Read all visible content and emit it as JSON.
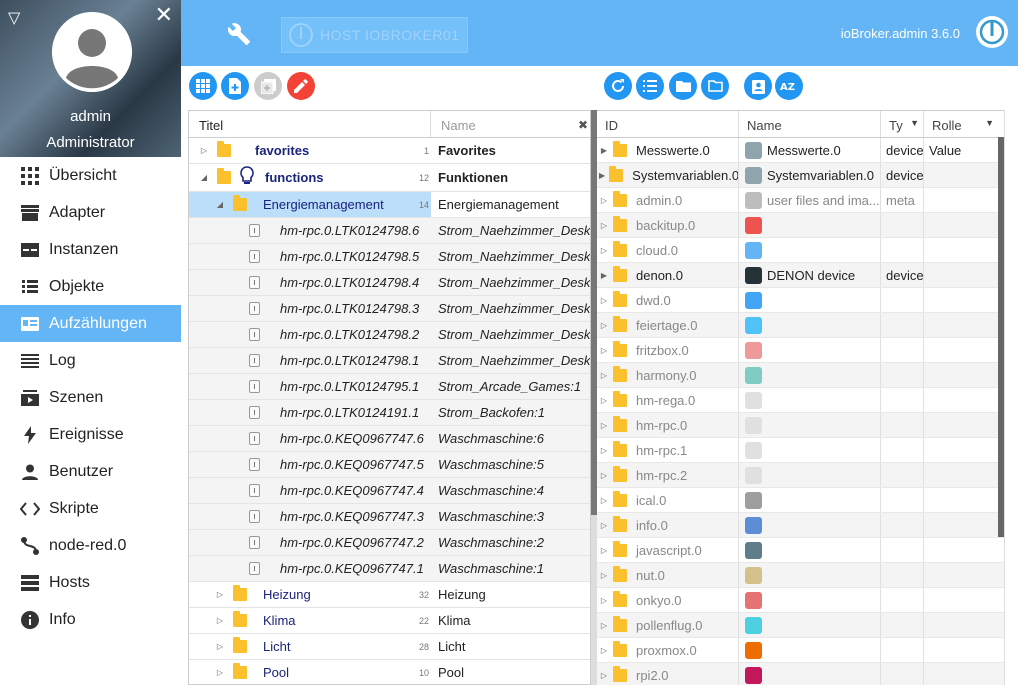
{
  "sidebar": {
    "user": "admin",
    "role": "Administrator",
    "items": [
      {
        "label": "Übersicht",
        "icon": "grid-icon"
      },
      {
        "label": "Adapter",
        "icon": "store-icon"
      },
      {
        "label": "Instanzen",
        "icon": "instances-icon"
      },
      {
        "label": "Objekte",
        "icon": "list-icon"
      },
      {
        "label": "Aufzählungen",
        "icon": "enum-icon",
        "active": true
      },
      {
        "label": "Log",
        "icon": "log-icon"
      },
      {
        "label": "Szenen",
        "icon": "scenes-icon"
      },
      {
        "label": "Ereignisse",
        "icon": "bolt-icon"
      },
      {
        "label": "Benutzer",
        "icon": "user-icon"
      },
      {
        "label": "Skripte",
        "icon": "code-icon"
      },
      {
        "label": "node-red.0",
        "icon": "node-red-icon"
      },
      {
        "label": "Hosts",
        "icon": "hosts-icon"
      },
      {
        "label": "Info",
        "icon": "info-icon"
      }
    ]
  },
  "topbar": {
    "host": "HOST IOBROKER01",
    "version": "ioBroker.admin 3.6.0"
  },
  "colors": {
    "accent": "#64b5f6",
    "button": "#2196f3",
    "danger": "#f44336",
    "folder": "#fbc02d"
  },
  "left_tree": {
    "col_title": "Titel",
    "col_name_placeholder": "Name",
    "rows": [
      {
        "title": "favorites",
        "count": "1",
        "name": "Favorites",
        "level": 0,
        "type": "folder",
        "style": "bold-blue",
        "arrow": "▷"
      },
      {
        "title": "functions",
        "count": "12",
        "name": "Funktionen",
        "level": 0,
        "type": "bulb",
        "style": "bold-blue",
        "arrow": "◢"
      },
      {
        "title": "Energiemanagement",
        "count": "14",
        "name": "Energiemanagement",
        "level": 1,
        "type": "folder",
        "style": "blue",
        "arrow": "◢",
        "selected": true
      },
      {
        "title": "hm-rpc.0.LTK0124798.6",
        "name": "Strom_Naehzimmer_Desk",
        "level": 2,
        "type": "state"
      },
      {
        "title": "hm-rpc.0.LTK0124798.5",
        "name": "Strom_Naehzimmer_Desk",
        "level": 2,
        "type": "state"
      },
      {
        "title": "hm-rpc.0.LTK0124798.4",
        "name": "Strom_Naehzimmer_Desk",
        "level": 2,
        "type": "state"
      },
      {
        "title": "hm-rpc.0.LTK0124798.3",
        "name": "Strom_Naehzimmer_Desk",
        "level": 2,
        "type": "state"
      },
      {
        "title": "hm-rpc.0.LTK0124798.2",
        "name": "Strom_Naehzimmer_Desk",
        "level": 2,
        "type": "state"
      },
      {
        "title": "hm-rpc.0.LTK0124798.1",
        "name": "Strom_Naehzimmer_Desk",
        "level": 2,
        "type": "state"
      },
      {
        "title": "hm-rpc.0.LTK0124795.1",
        "name": "Strom_Arcade_Games:1",
        "level": 2,
        "type": "state"
      },
      {
        "title": "hm-rpc.0.LTK0124191.1",
        "name": "Strom_Backofen:1",
        "level": 2,
        "type": "state"
      },
      {
        "title": "hm-rpc.0.KEQ0967747.6",
        "name": "Waschmaschine:6",
        "level": 2,
        "type": "state"
      },
      {
        "title": "hm-rpc.0.KEQ0967747.5",
        "name": "Waschmaschine:5",
        "level": 2,
        "type": "state"
      },
      {
        "title": "hm-rpc.0.KEQ0967747.4",
        "name": "Waschmaschine:4",
        "level": 2,
        "type": "state"
      },
      {
        "title": "hm-rpc.0.KEQ0967747.3",
        "name": "Waschmaschine:3",
        "level": 2,
        "type": "state"
      },
      {
        "title": "hm-rpc.0.KEQ0967747.2",
        "name": "Waschmaschine:2",
        "level": 2,
        "type": "state"
      },
      {
        "title": "hm-rpc.0.KEQ0967747.1",
        "name": "Waschmaschine:1",
        "level": 2,
        "type": "state"
      },
      {
        "title": "Heizung",
        "count": "32",
        "name": "Heizung",
        "level": 1,
        "type": "folder",
        "style": "blue",
        "arrow": "▷"
      },
      {
        "title": "Klima",
        "count": "22",
        "name": "Klima",
        "level": 1,
        "type": "folder",
        "style": "blue",
        "arrow": "▷"
      },
      {
        "title": "Licht",
        "count": "28",
        "name": "Licht",
        "level": 1,
        "type": "folder",
        "style": "blue",
        "arrow": "▷"
      },
      {
        "title": "Pool",
        "count": "10",
        "name": "Pool",
        "level": 1,
        "type": "folder",
        "style": "blue",
        "arrow": "▷"
      }
    ]
  },
  "right_grid": {
    "col_id": "ID",
    "col_name": "Name",
    "col_type": "Ty",
    "col_role": "Rolle",
    "rows": [
      {
        "id": "Messwerte.0",
        "name": "Messwerte.0",
        "type": "device",
        "role": "Value",
        "icon": "#90a4ae",
        "gray": false
      },
      {
        "id": "Systemvariablen.0",
        "name": "Systemvariablen.0",
        "type": "device",
        "role": "",
        "icon": "#90a4ae",
        "gray": false
      },
      {
        "id": "admin.0",
        "name": "user files and ima...",
        "type": "meta",
        "role": "",
        "icon": "#bdbdbd",
        "gray": true
      },
      {
        "id": "backitup.0",
        "name": "",
        "type": "",
        "role": "",
        "icon": "#ef5350",
        "gray": true
      },
      {
        "id": "cloud.0",
        "name": "",
        "type": "",
        "role": "",
        "icon": "#64b5f6",
        "gray": true
      },
      {
        "id": "denon.0",
        "name": "DENON device",
        "type": "device",
        "role": "",
        "icon": "#263238",
        "gray": false
      },
      {
        "id": "dwd.0",
        "name": "",
        "type": "",
        "role": "",
        "icon": "#42a5f5",
        "gray": true
      },
      {
        "id": "feiertage.0",
        "name": "",
        "type": "",
        "role": "",
        "icon": "#4fc3f7",
        "gray": true
      },
      {
        "id": "fritzbox.0",
        "name": "",
        "type": "",
        "role": "",
        "icon": "#ef9a9a",
        "gray": true
      },
      {
        "id": "harmony.0",
        "name": "",
        "type": "",
        "role": "",
        "icon": "#80cbc4",
        "gray": true
      },
      {
        "id": "hm-rega.0",
        "name": "",
        "type": "",
        "role": "",
        "icon": "#e0e0e0",
        "gray": true
      },
      {
        "id": "hm-rpc.0",
        "name": "",
        "type": "",
        "role": "",
        "icon": "#e0e0e0",
        "gray": true
      },
      {
        "id": "hm-rpc.1",
        "name": "",
        "type": "",
        "role": "",
        "icon": "#e0e0e0",
        "gray": true
      },
      {
        "id": "hm-rpc.2",
        "name": "",
        "type": "",
        "role": "",
        "icon": "#e0e0e0",
        "gray": true
      },
      {
        "id": "ical.0",
        "name": "",
        "type": "",
        "role": "",
        "icon": "#9e9e9e",
        "gray": true
      },
      {
        "id": "info.0",
        "name": "",
        "type": "",
        "role": "",
        "icon": "#5c8dd6",
        "gray": true
      },
      {
        "id": "javascript.0",
        "name": "",
        "type": "",
        "role": "",
        "icon": "#607d8b",
        "gray": true
      },
      {
        "id": "nut.0",
        "name": "",
        "type": "",
        "role": "",
        "icon": "#d4c08c",
        "gray": true
      },
      {
        "id": "onkyo.0",
        "name": "",
        "type": "",
        "role": "",
        "icon": "#e57373",
        "gray": true
      },
      {
        "id": "pollenflug.0",
        "name": "",
        "type": "",
        "role": "",
        "icon": "#4dd0e1",
        "gray": true
      },
      {
        "id": "proxmox.0",
        "name": "",
        "type": "",
        "role": "",
        "icon": "#ef6c00",
        "gray": true
      },
      {
        "id": "rpi2.0",
        "name": "",
        "type": "",
        "role": "",
        "icon": "#c2185b",
        "gray": true
      }
    ]
  }
}
